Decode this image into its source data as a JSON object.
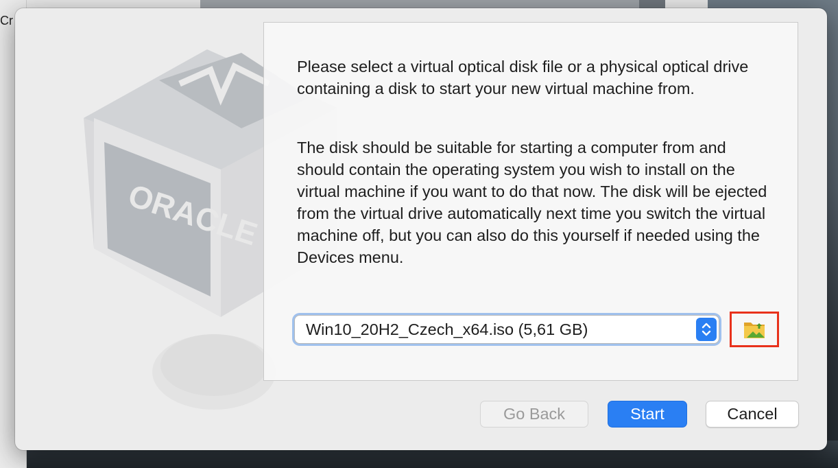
{
  "background": {
    "window_title_fragment": "Cr"
  },
  "dialog": {
    "watermark_brand": "ORACLE",
    "paragraph_1": "Please select a virtual optical disk file or a physical optical drive containing a disk to start your new virtual machine from.",
    "paragraph_2": "The disk should be suitable for starting a computer from and should contain the operating system you wish to install on the virtual machine if you want to do that now. The disk will be ejected from the virtual drive automatically next time you switch the virtual machine off, but you can also do this yourself if needed using the Devices menu.",
    "disk_select": {
      "value": "Win10_20H2_Czech_x64.iso (5,61 GB)",
      "stepper_icon": "up-down-chevron-icon"
    },
    "choose_disk_icon": "folder-add-icon",
    "highlight_color": "#e8311b",
    "buttons": {
      "go_back": "Go Back",
      "start": "Start",
      "cancel": "Cancel"
    },
    "accent_color": "#2a7ff3"
  }
}
